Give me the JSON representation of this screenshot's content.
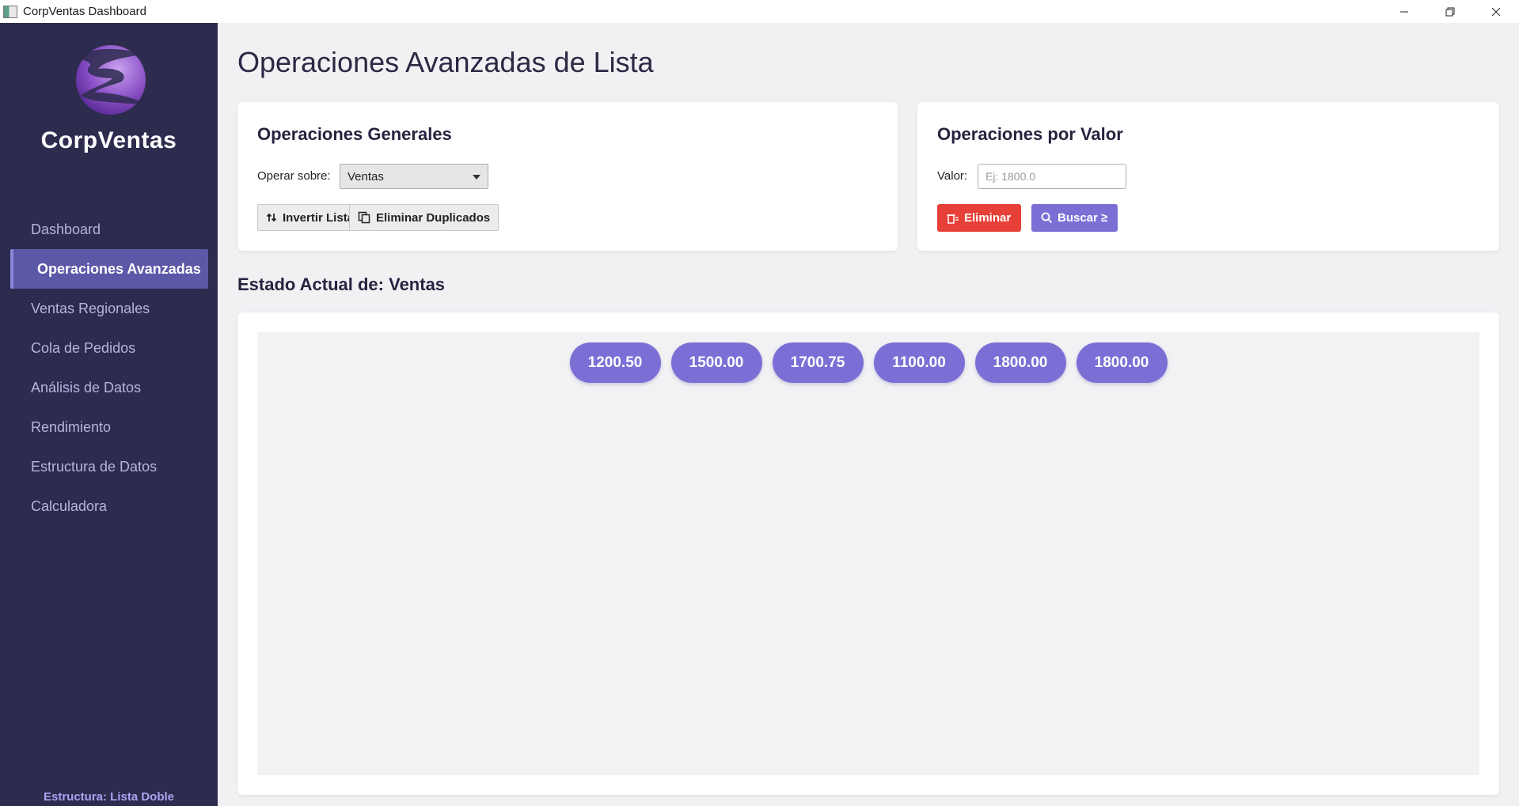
{
  "window": {
    "title": "CorpVentas Dashboard"
  },
  "sidebar": {
    "brand": "CorpVentas",
    "items": [
      {
        "label": "Dashboard"
      },
      {
        "label": "Operaciones Avanzadas"
      },
      {
        "label": "Ventas Regionales"
      },
      {
        "label": "Cola de Pedidos"
      },
      {
        "label": "Análisis de Datos"
      },
      {
        "label": "Rendimiento"
      },
      {
        "label": "Estructura de Datos"
      },
      {
        "label": "Calculadora"
      }
    ],
    "active_index": 1,
    "footer": "Estructura: Lista Doble"
  },
  "main": {
    "title": "Operaciones Avanzadas de Lista",
    "general": {
      "heading": "Operaciones Generales",
      "operate_label": "Operar sobre:",
      "operate_value": "Ventas",
      "invert_label": "Invertir Lista",
      "dedupe_label": "Eliminar Duplicados"
    },
    "by_value": {
      "heading": "Operaciones por Valor",
      "value_label": "Valor:",
      "value_placeholder": "Ej: 1800.0",
      "delete_label": "Eliminar",
      "search_label": "Buscar ≥"
    },
    "state": {
      "heading": "Estado Actual de: Ventas",
      "items": [
        "1200.50",
        "1500.00",
        "1700.75",
        "1100.00",
        "1800.00",
        "1800.00"
      ]
    }
  },
  "colors": {
    "sidebar_bg": "#2d2b4e",
    "accent": "#7b6fd6",
    "danger": "#e64038",
    "active_nav": "#5c58a8"
  }
}
